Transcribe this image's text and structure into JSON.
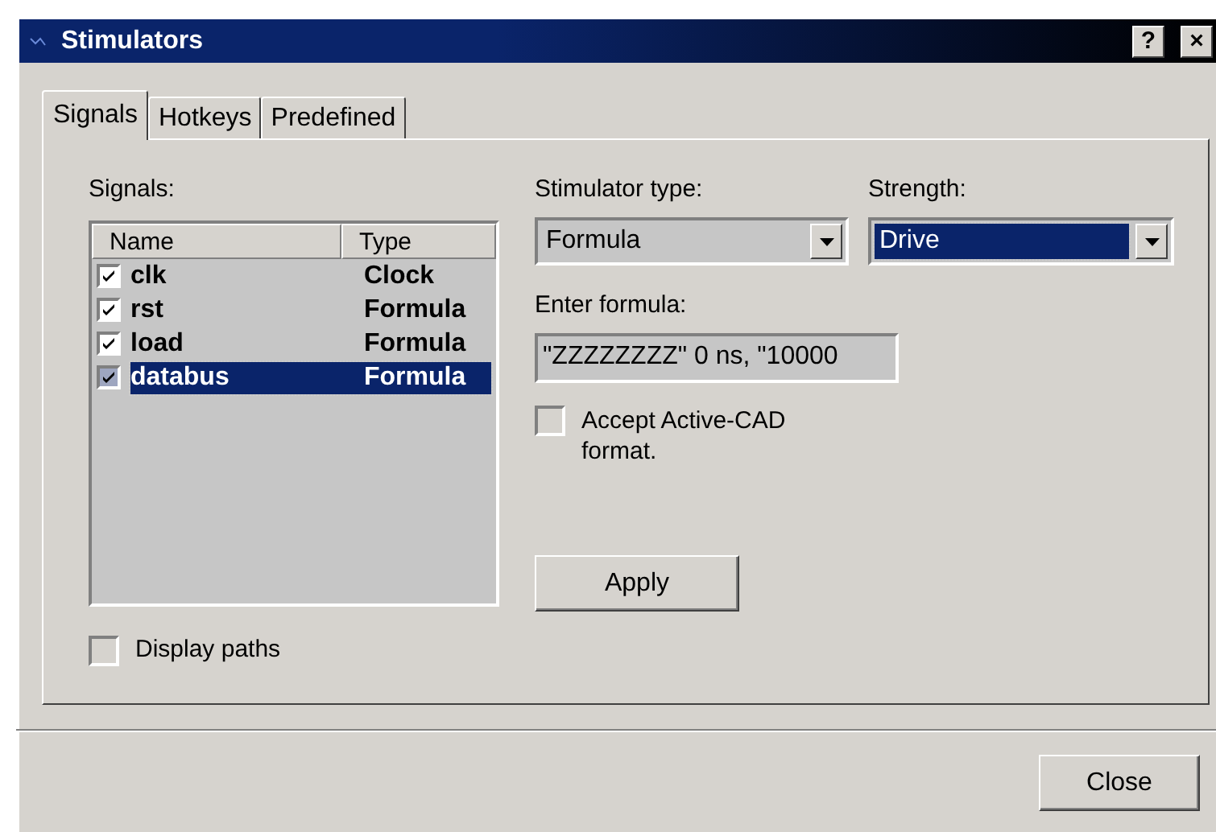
{
  "window": {
    "title": "Stimulators",
    "help_button": "?",
    "close_button": "×"
  },
  "tabs": [
    {
      "label": "Signals",
      "selected": true
    },
    {
      "label": "Hotkeys",
      "selected": false
    },
    {
      "label": "Predefined",
      "selected": false
    }
  ],
  "signals": {
    "label": "Signals:",
    "columns": [
      "Name",
      "Type"
    ],
    "rows": [
      {
        "name": "clk",
        "type": "Clock",
        "checked": true,
        "selected": false
      },
      {
        "name": "rst",
        "type": "Formula",
        "checked": true,
        "selected": false
      },
      {
        "name": "load",
        "type": "Formula",
        "checked": true,
        "selected": false
      },
      {
        "name": "databus",
        "type": "Formula",
        "checked": true,
        "selected": true
      }
    ],
    "display_paths": {
      "label": "Display paths",
      "checked": false
    }
  },
  "stimulator_type": {
    "label": "Stimulator type:",
    "value": "Formula",
    "focused": false
  },
  "strength": {
    "label": "Strength:",
    "value": "Drive",
    "focused": true
  },
  "formula": {
    "label": "Enter formula:",
    "value": "\"ZZZZZZZZ\" 0 ns, \"10000"
  },
  "accept_active_cad": {
    "label": "Accept Active-CAD format.",
    "checked": false
  },
  "buttons": {
    "apply": "Apply",
    "close": "Close"
  }
}
